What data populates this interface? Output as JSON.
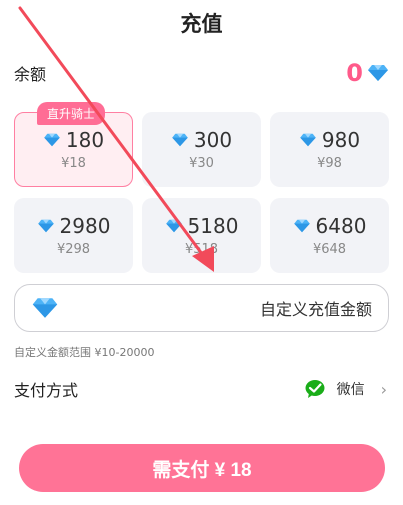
{
  "header": {
    "title": "充值"
  },
  "balance": {
    "label": "余额",
    "value": "0",
    "icon": "diamond-icon"
  },
  "packages": [
    {
      "amount": "180",
      "price": "¥18",
      "badge": "直升骑士",
      "selected": true
    },
    {
      "amount": "300",
      "price": "¥30",
      "selected": false
    },
    {
      "amount": "980",
      "price": "¥98",
      "selected": false
    },
    {
      "amount": "2980",
      "price": "¥298",
      "selected": false
    },
    {
      "amount": "5180",
      "price": "¥518",
      "selected": false
    },
    {
      "amount": "6480",
      "price": "¥648",
      "selected": false
    }
  ],
  "custom": {
    "placeholder": "自定义充值金额",
    "range_hint": "自定义金额范围 ¥10-20000"
  },
  "payment": {
    "label": "支付方式",
    "method": "微信",
    "icon": "wechat-icon"
  },
  "pay_button": {
    "label": "需支付 ¥ 18"
  },
  "colors": {
    "accent": "#ff7396",
    "balance": "#ff5a8a",
    "diamond": "#3fa9f5",
    "wechat": "#1aad19",
    "annotation_arrow": "#f24a5a"
  }
}
